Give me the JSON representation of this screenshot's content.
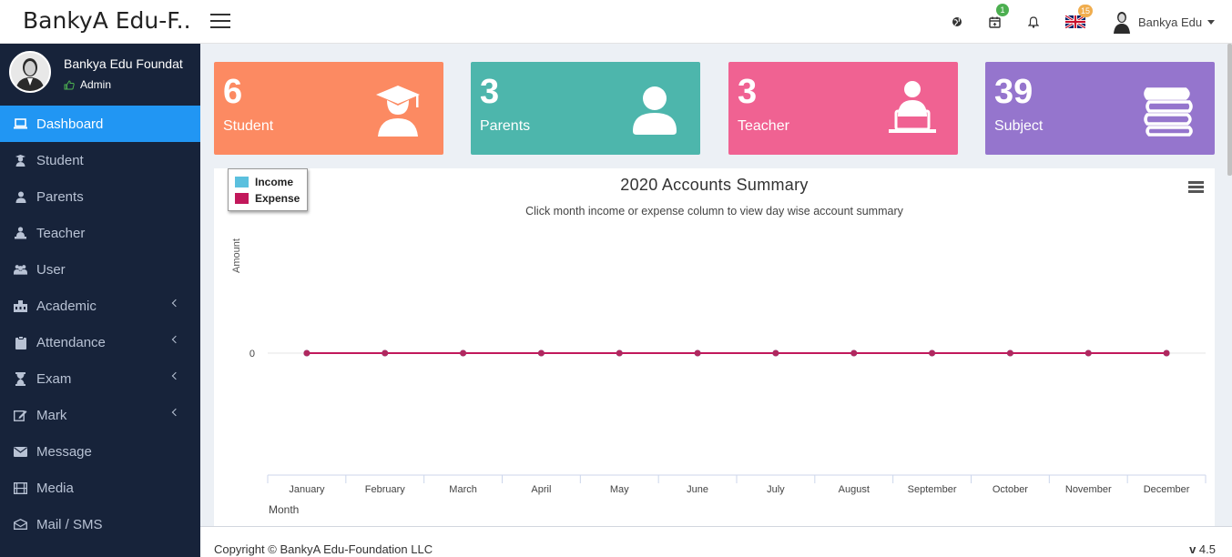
{
  "header": {
    "brand": "BankyA Edu-F..",
    "calendar_badge": "1",
    "flag_badge": "15",
    "user_name": "Bankya Edu",
    "colors": {
      "green_badge": "#4caf50",
      "orange_badge": "#f0ad4e"
    }
  },
  "sidebar": {
    "profile_name": "Bankya Edu Foundat",
    "profile_role": "Admin",
    "items": [
      {
        "label": "Dashboard",
        "icon": "laptop-icon",
        "active": true
      },
      {
        "label": "Student",
        "icon": "student-icon"
      },
      {
        "label": "Parents",
        "icon": "user-icon"
      },
      {
        "label": "Teacher",
        "icon": "teacher-icon"
      },
      {
        "label": "User",
        "icon": "users-icon"
      },
      {
        "label": "Academic",
        "icon": "institution-icon",
        "submenu": true
      },
      {
        "label": "Attendance",
        "icon": "clipboard-icon",
        "submenu": true
      },
      {
        "label": "Exam",
        "icon": "hourglass-icon",
        "submenu": true
      },
      {
        "label": "Mark",
        "icon": "edit-icon",
        "submenu": true
      },
      {
        "label": "Message",
        "icon": "envelope-icon"
      },
      {
        "label": "Media",
        "icon": "film-icon"
      },
      {
        "label": "Mail / SMS",
        "icon": "mail-icon"
      }
    ]
  },
  "stats": [
    {
      "number": "6",
      "label": "Student",
      "color": "#fc8a62",
      "icon": "graduate-icon"
    },
    {
      "number": "3",
      "label": "Parents",
      "color": "#4db6ac",
      "icon": "user-icon"
    },
    {
      "number": "3",
      "label": "Teacher",
      "color": "#f06292",
      "icon": "teacher-icon"
    },
    {
      "number": "39",
      "label": "Subject",
      "color": "#9575cd",
      "icon": "books-icon"
    }
  ],
  "chart_data": {
    "type": "line",
    "title": "2020 Accounts Summary",
    "subtitle": "Click month income or expense column to view day wise account summary",
    "xlabel": "Month",
    "ylabel": "Amount",
    "categories": [
      "January",
      "February",
      "March",
      "April",
      "May",
      "June",
      "July",
      "August",
      "September",
      "October",
      "November",
      "December"
    ],
    "series": [
      {
        "name": "Income",
        "color": "#5bc0de",
        "values": [
          0,
          0,
          0,
          0,
          0,
          0,
          0,
          0,
          0,
          0,
          0,
          0
        ]
      },
      {
        "name": "Expense",
        "color": "#c2185b",
        "values": [
          0,
          0,
          0,
          0,
          0,
          0,
          0,
          0,
          0,
          0,
          0,
          0
        ]
      }
    ],
    "yticks": [
      "0"
    ],
    "legend": "top-left"
  },
  "footer": {
    "copyright": "Copyright © BankyA Edu-Foundation LLC",
    "version_prefix": "v",
    "version_number": "4.5"
  }
}
